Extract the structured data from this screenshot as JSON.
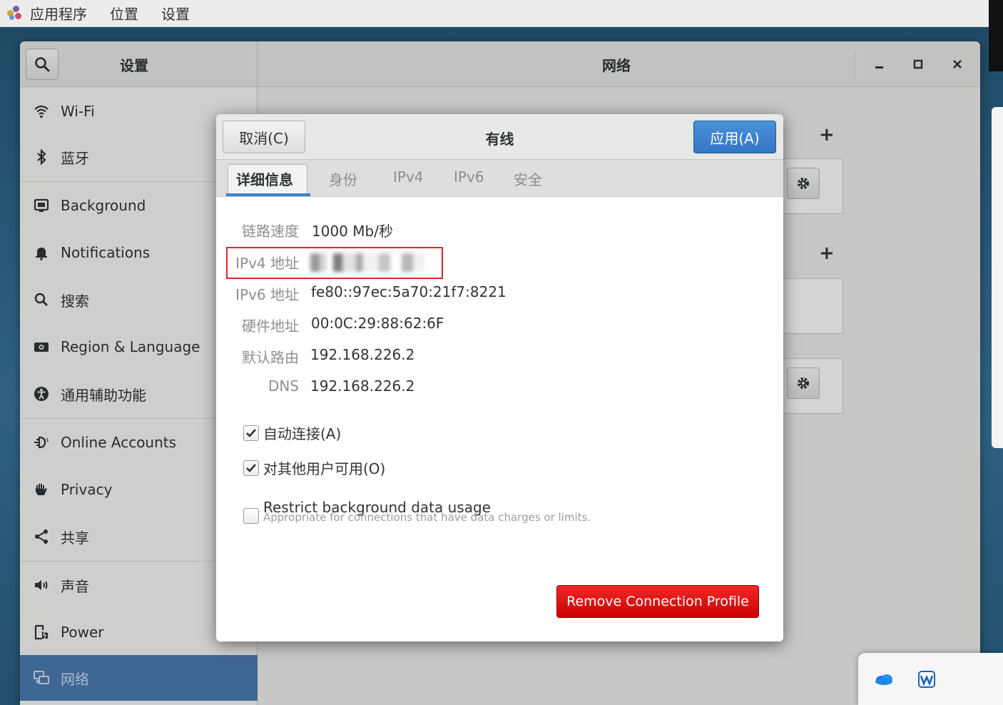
{
  "top_panel": {
    "items": [
      "应用程序",
      "位置",
      "设置"
    ]
  },
  "window": {
    "sidebar_title": "设置",
    "main_title": "网络",
    "controls": {
      "minimize": "–",
      "maximize": "□",
      "close": "×"
    }
  },
  "sidebar": {
    "items": [
      {
        "label": "Wi-Fi",
        "icon": "wifi-icon"
      },
      {
        "label": "蓝牙",
        "icon": "bluetooth-icon"
      },
      {
        "label": "Background",
        "icon": "background-icon"
      },
      {
        "label": "Notifications",
        "icon": "bell-icon"
      },
      {
        "label": "搜索",
        "icon": "search-icon"
      },
      {
        "label": "Region & Language",
        "icon": "region-icon"
      },
      {
        "label": "通用辅助功能",
        "icon": "accessibility-icon"
      },
      {
        "label": "Online Accounts",
        "icon": "online-accounts-icon"
      },
      {
        "label": "Privacy",
        "icon": "hand-icon"
      },
      {
        "label": "共享",
        "icon": "share-icon"
      },
      {
        "label": "声音",
        "icon": "speaker-icon"
      },
      {
        "label": "Power",
        "icon": "power-icon"
      },
      {
        "label": "网络",
        "icon": "network-icon",
        "selected": true
      }
    ]
  },
  "main_pane": {
    "add_symbol": "+"
  },
  "dialog": {
    "title": "有线",
    "cancel_label": "取消(C)",
    "apply_label": "应用(A)",
    "tabs": [
      "详细信息",
      "身份",
      "IPv4",
      "IPv6",
      "安全"
    ],
    "active_tab": "详细信息",
    "details": [
      {
        "label": "链路速度",
        "value": "1000 Mb/秒"
      },
      {
        "label": "IPv4 地址",
        "value": "",
        "redacted": true
      },
      {
        "label": "IPv6 地址",
        "value": "fe80::97ec:5a70:21f7:8221"
      },
      {
        "label": "硬件地址",
        "value": "00:0C:29:88:62:6F"
      },
      {
        "label": "默认路由",
        "value": "192.168.226.2"
      },
      {
        "label": "DNS",
        "value": "192.168.226.2"
      }
    ],
    "auto_connect": {
      "label": "自动连接(A)",
      "checked": true
    },
    "all_users": {
      "label": "对其他用户可用(O)",
      "checked": true
    },
    "restrict": {
      "label": "Restrict background data usage",
      "sub": "Appropriate for connections that have data charges or limits.",
      "checked": false
    },
    "remove_label": "Remove Connection Profile"
  },
  "colors": {
    "accent": "#3d80d0",
    "apply_button": "#3b7fcb",
    "remove_button": "#e01b1b",
    "selected_sidebar": "#4a78ac",
    "highlight_box": "#e0262b"
  }
}
